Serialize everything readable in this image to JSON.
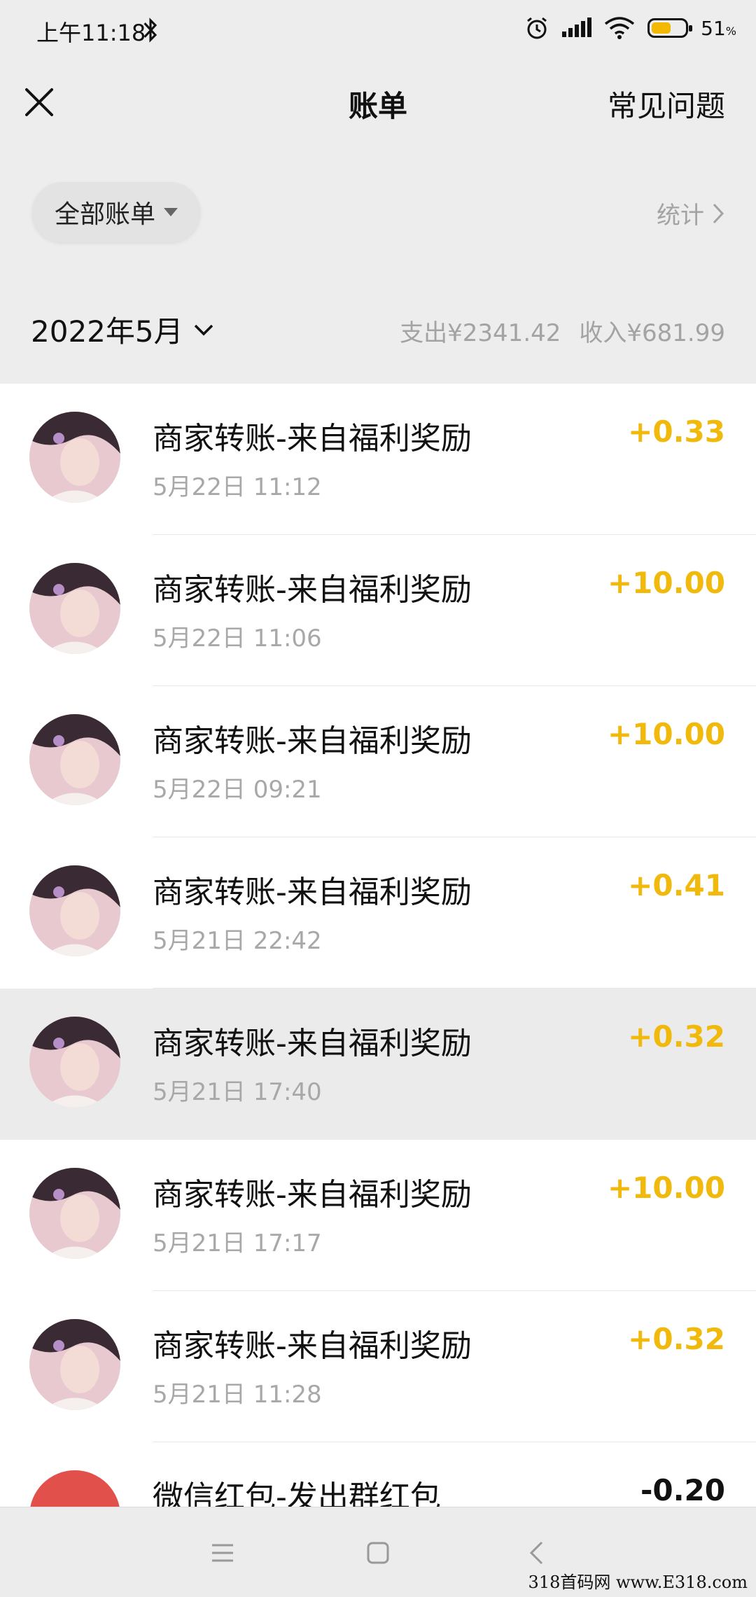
{
  "status_bar": {
    "time": "上午11:18",
    "battery_pct": "51",
    "battery_unit": "%"
  },
  "header": {
    "title": "账单",
    "faq_label": "常见问题"
  },
  "filter": {
    "label": "全部账单",
    "stats_label": "统计"
  },
  "month": {
    "label": "2022年5月",
    "expense": "支出¥2341.42",
    "income": "收入¥681.99"
  },
  "items": [
    {
      "title": "商家转账-来自福利奖励",
      "time": "5月22日 11:12",
      "amount": "+0.33"
    },
    {
      "title": "商家转账-来自福利奖励",
      "time": "5月22日 11:06",
      "amount": "+10.00"
    },
    {
      "title": "商家转账-来自福利奖励",
      "time": "5月22日 09:21",
      "amount": "+10.00"
    },
    {
      "title": "商家转账-来自福利奖励",
      "time": "5月21日 22:42",
      "amount": "+0.41"
    },
    {
      "title": "商家转账-来自福利奖励",
      "time": "5月21日 17:40",
      "amount": "+0.32"
    },
    {
      "title": "商家转账-来自福利奖励",
      "time": "5月21日 17:17",
      "amount": "+10.00"
    },
    {
      "title": "商家转账-来自福利奖励",
      "time": "5月21日 11:28",
      "amount": "+0.32"
    },
    {
      "title": "微信红包-发出群红包",
      "time": "",
      "amount": "-0.20"
    }
  ],
  "watermark": "318首码网 www.E318.com",
  "colors": {
    "income": "#f0b90b",
    "background": "#ededed",
    "muted": "#a8a8a8"
  }
}
